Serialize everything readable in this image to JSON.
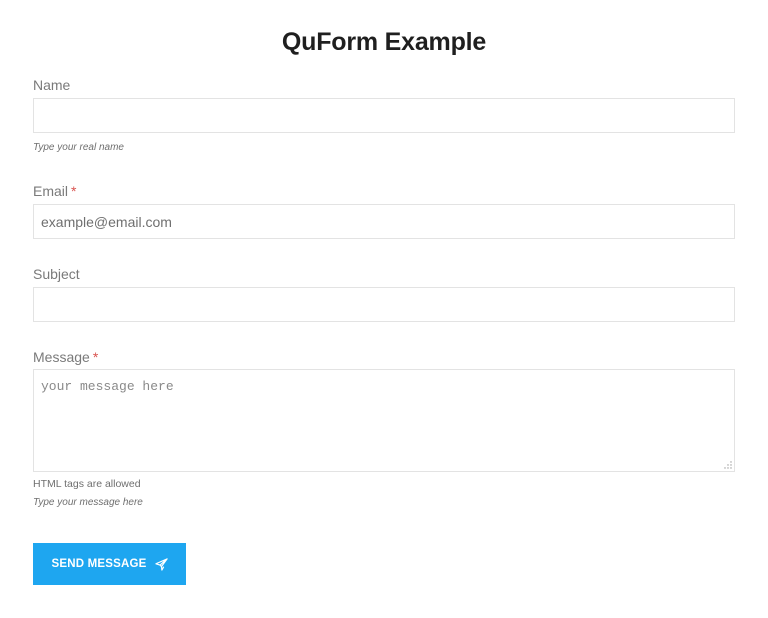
{
  "form": {
    "title": "QuForm Example",
    "name": {
      "label": "Name",
      "value": "",
      "placeholder": "",
      "hint": "Type your real name"
    },
    "email": {
      "label": "Email",
      "required_mark": "*",
      "value": "",
      "placeholder": "example@email.com"
    },
    "subject": {
      "label": "Subject",
      "value": "",
      "placeholder": ""
    },
    "message": {
      "label": "Message",
      "required_mark": "*",
      "value": "",
      "placeholder": "your message here",
      "note": "HTML tags are allowed",
      "hint": "Type your message here"
    },
    "submit": {
      "label": "SEND MESSAGE",
      "icon": "paper-plane-icon"
    }
  },
  "colors": {
    "accent": "#1ea6f0",
    "required": "#d9534f",
    "label": "#7a7a7a",
    "border": "#e3e3e3",
    "title": "#1f1f1f"
  }
}
